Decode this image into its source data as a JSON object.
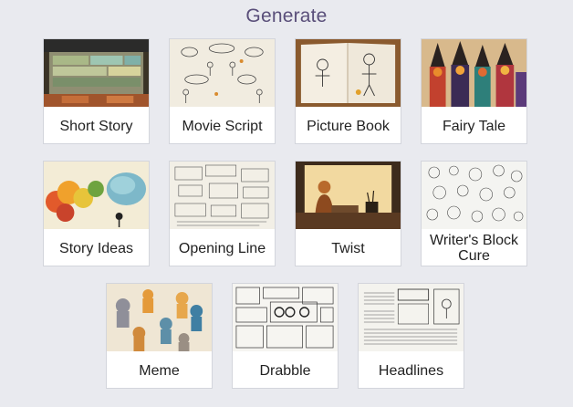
{
  "header": {
    "title": "Generate"
  },
  "cards": [
    {
      "label": "Short Story"
    },
    {
      "label": "Movie Script"
    },
    {
      "label": "Picture Book"
    },
    {
      "label": "Fairy Tale"
    },
    {
      "label": "Story Ideas"
    },
    {
      "label": "Opening Line"
    },
    {
      "label": "Twist"
    },
    {
      "label": "Writer's Block Cure"
    },
    {
      "label": "Meme"
    },
    {
      "label": "Drabble"
    },
    {
      "label": "Headlines"
    }
  ]
}
